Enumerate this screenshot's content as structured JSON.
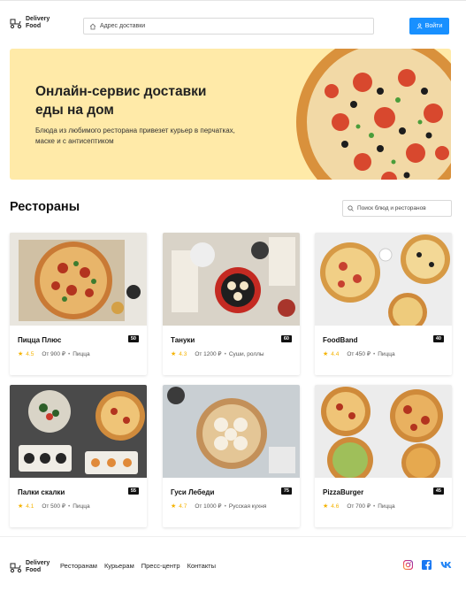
{
  "header": {
    "logo_line1": "Delivery",
    "logo_line2": "Food",
    "address_placeholder": "Адрес доставки",
    "login_label": "Войти"
  },
  "promo": {
    "title": "Онлайн-сервис доставки еды на дом",
    "subtitle": "Блюда из любимого ресторана привезет курьер в перчатках, маске и с антисептиком"
  },
  "restaurants": {
    "title": "Рестораны",
    "search_placeholder": "Поиск блюд и ресторанов",
    "items": [
      {
        "name": "Пицца Плюс",
        "time": "50",
        "rating": "4.5",
        "price": "От 900 ₽",
        "category": "Пицца"
      },
      {
        "name": "Тануки",
        "time": "60",
        "rating": "4.3",
        "price": "От 1200 ₽",
        "category": "Суши, роллы"
      },
      {
        "name": "FoodBand",
        "time": "40",
        "rating": "4.4",
        "price": "От 450 ₽",
        "category": "Пицца"
      },
      {
        "name": "Палки скалки",
        "time": "55",
        "rating": "4.1",
        "price": "От 500 ₽",
        "category": "Пицца"
      },
      {
        "name": "Гуси Лебеди",
        "time": "75",
        "rating": "4.7",
        "price": "От 1000 ₽",
        "category": "Русская кухня"
      },
      {
        "name": "PizzaBurger",
        "time": "45",
        "rating": "4.6",
        "price": "От 700 ₽",
        "category": "Пицца"
      }
    ]
  },
  "footer": {
    "logo_line1": "Delivery",
    "logo_line2": "Food",
    "links": [
      "Ресторанам",
      "Курьерам",
      "Пресс-центр",
      "Контакты"
    ],
    "social_icons": [
      "instagram-icon",
      "facebook-icon",
      "vk-icon"
    ]
  },
  "colors": {
    "accent": "#1890ff",
    "promo_bg": "#ffeaa8",
    "rating": "#f5b301"
  }
}
